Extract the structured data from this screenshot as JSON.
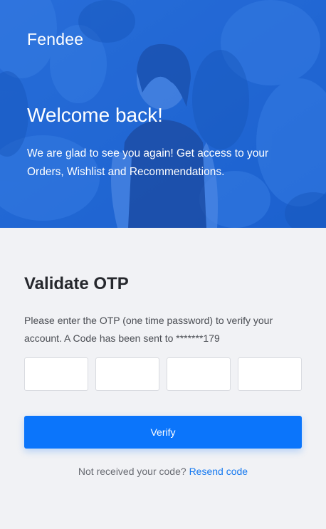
{
  "hero": {
    "brand": "Fendee",
    "title": "Welcome back!",
    "subtitle": "We are glad to see you again! Get access to your Orders, Wishlist and Recommendations."
  },
  "otp": {
    "title": "Validate OTP",
    "description": "Please enter the OTP (one time password) to verify your account. A Code has been sent to *******179",
    "boxes": [
      {
        "value": ""
      },
      {
        "value": ""
      },
      {
        "value": ""
      },
      {
        "value": ""
      }
    ],
    "verify_label": "Verify",
    "resend_prompt": "Not received your code?",
    "resend_link": "Resend code"
  },
  "colors": {
    "accent": "#0b75fb",
    "hero_overlay": "#1f66d6",
    "link": "#1478f0",
    "panel_bg": "#f1f2f5"
  }
}
